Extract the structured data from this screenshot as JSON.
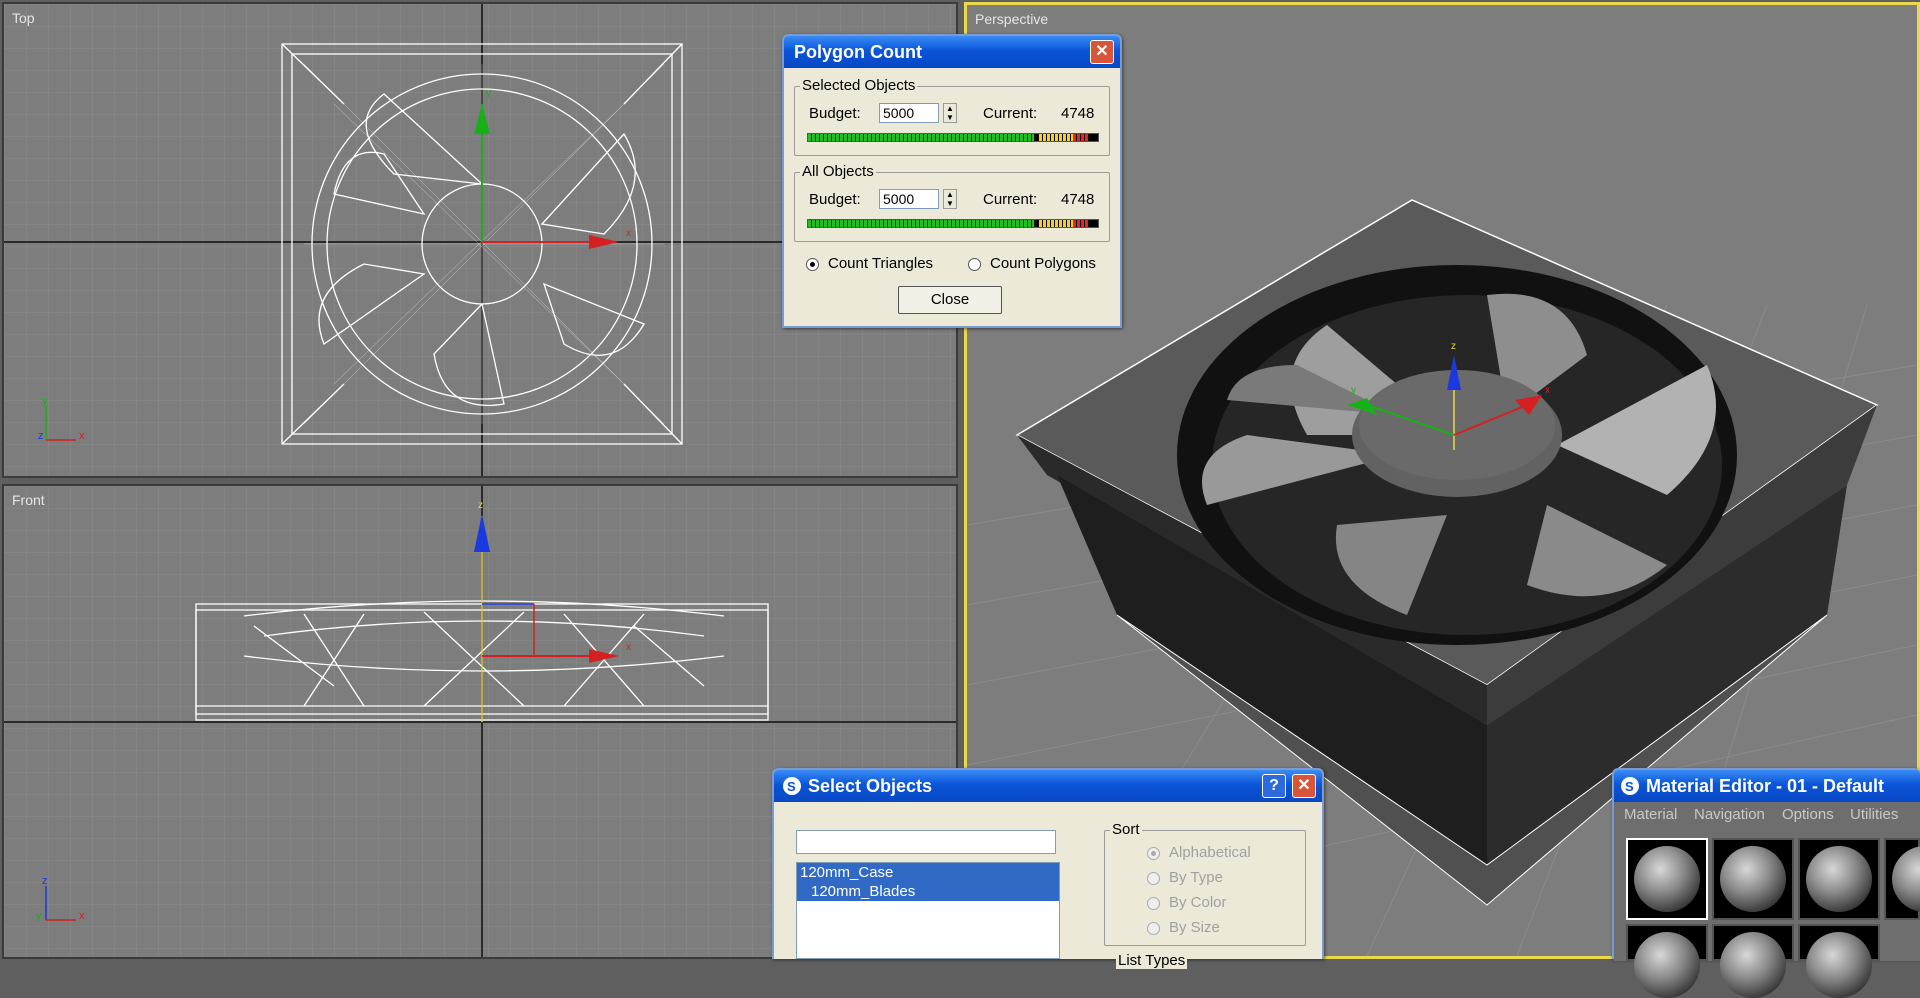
{
  "viewports": {
    "top": {
      "label": "Top"
    },
    "front": {
      "label": "Front"
    },
    "perspective": {
      "label": "Perspective"
    }
  },
  "axes": {
    "x": "x",
    "y": "y",
    "z": "z"
  },
  "polygon_count": {
    "title": "Polygon Count",
    "close_icon": "close-icon",
    "selected_group": "Selected Objects",
    "all_group": "All Objects",
    "budget_label": "Budget:",
    "current_label": "Current:",
    "selected_budget": "5000",
    "selected_current": "4748",
    "all_budget": "5000",
    "all_current": "4748",
    "count_triangles": "Count Triangles",
    "count_polygons": "Count Polygons",
    "count_mode": "triangles",
    "usage_fraction": 0.95,
    "close_button": "Close"
  },
  "select_objects": {
    "title": "Select Objects",
    "help_icon": "help-icon",
    "close_icon": "close-icon",
    "search_value": "",
    "items": [
      "120mm_Case",
      "120mm_Blades"
    ],
    "sort_title": "Sort",
    "sort_options": [
      "Alphabetical",
      "By Type",
      "By Color",
      "By Size"
    ],
    "sort_selected": "Alphabetical",
    "list_types_title": "List Types"
  },
  "material_editor": {
    "title": "Material Editor - 01 - Default",
    "app_icon": "3dsmax-logo-icon",
    "menu": [
      "Material",
      "Navigation",
      "Options",
      "Utilities"
    ]
  },
  "colors": {
    "viewport_bg": "#7d7d7d",
    "active_border": "#e8d84a",
    "xp_title": "#0a55d8",
    "axis_x": "#d42020",
    "axis_y": "#18b018",
    "axis_z": "#1a3ae0"
  }
}
